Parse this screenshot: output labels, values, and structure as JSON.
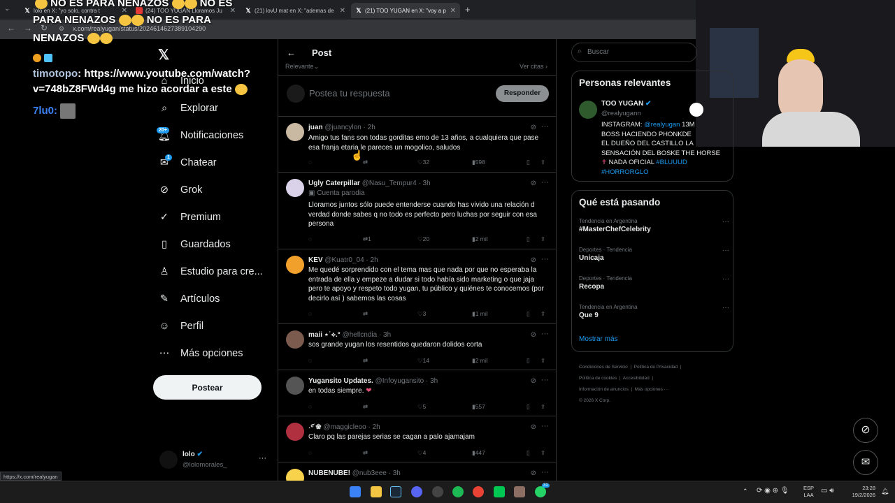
{
  "browser": {
    "tabs": [
      {
        "label": "lolo en X: \"yo solo, contra t"
      },
      {
        "label": "(24) TOO YUGAN Lloramos Ju"
      },
      {
        "label": "(21) lovU mat en X: \"ademas de"
      },
      {
        "label": "(21) TOO YUGAN en X: \"voy a p"
      }
    ],
    "url": "x.com/realyugan/status/2024614627389104290",
    "status_url": "https://x.com/realyugan"
  },
  "overlay_chat": {
    "line1": "NO ES PARA NENAZOS",
    "line1b": "NO ES",
    "line2": "PARA NENAZOS",
    "line2b": "NO ES PARA",
    "line3": "NENAZOS",
    "timo_user": "timotopo",
    "timo_msg": ": https://www.youtube.com/watch?",
    "timo_msg2": "v=748bZ8FWd4g me hizo acordar a este",
    "user3": "7lu0:"
  },
  "sidebar": {
    "items": [
      {
        "label": "Inicio"
      },
      {
        "label": "Explorar"
      },
      {
        "label": "Notificaciones",
        "badge": "20+"
      },
      {
        "label": "Chatear",
        "badge": "1"
      },
      {
        "label": "Grok"
      },
      {
        "label": "Premium"
      },
      {
        "label": "Guardados"
      },
      {
        "label": "Estudio para cre..."
      },
      {
        "label": "Artículos"
      },
      {
        "label": "Perfil"
      },
      {
        "label": "Más opciones"
      }
    ],
    "post_button": "Postear",
    "account_name": "lolo",
    "account_handle": "@lolomorales_",
    "account_more": "···"
  },
  "main": {
    "header_title": "Post",
    "sort_label": "Relevante",
    "quotes_label": "Ver citas",
    "reply_placeholder": "Postea tu respuesta",
    "reply_button": "Responder",
    "tweets": [
      {
        "name": "juan",
        "handle": "@juancylon · 2h",
        "text": "Amigo tus fans son todas gorditas emo de 13 años, a cualquiera que pase esa franja etaria le pareces un mogolico, saludos",
        "reposts": "",
        "likes": "32",
        "views": "598"
      },
      {
        "name": "Ugly Caterpillar",
        "handle": "@Nasu_Tempur4 · 3h",
        "sub": "Cuenta parodia",
        "text": "Lloramos juntos sólo puede entenderse cuando has vivido una relación d verdad donde sabes q no todo es perfecto pero luchas por seguir con esa persona",
        "reposts": "1",
        "likes": "20",
        "views": "2 mil"
      },
      {
        "name": "KEV",
        "handle": "@Kuatr0_04 · 2h",
        "text": "Me quedé sorprendido con el tema mas que nada por que no esperaba la entrada de ella y empeze a dudar si todo había sido marketing o que jaja pero te apoyo y respeto todo yugan, tu público y quiénes te conocemos (por decirlo así ) sabemos las cosas",
        "reposts": "",
        "likes": "3",
        "views": "1 mil"
      },
      {
        "name": "maii ⋆˙⟡.°",
        "handle": "@hellcndia · 3h",
        "text": "sos grande yugan los resentidos quedaron dolidos corta",
        "reposts": "",
        "likes": "14",
        "views": "2 mil"
      },
      {
        "name": "Yugansito Updates.",
        "handle": "@Infoyugansito · 3h",
        "text": "en todas siempre.",
        "reposts": "",
        "likes": "5",
        "views": "557"
      },
      {
        "name": "˖ᵒ᷄ ❀",
        "handle": "@maggicleoo · 2h",
        "text": "Claro pq las parejas serias se cagan a palo ajamajam",
        "reposts": "",
        "likes": "4",
        "views": "447"
      },
      {
        "name": "NUBENUBE!",
        "handle": "@nub3eee · 3h",
        "text": "",
        "reposts": "",
        "likes": "",
        "views": ""
      }
    ]
  },
  "right": {
    "search_placeholder": "Buscar",
    "relevant_title": "Personas relevantes",
    "person_name": "TOO YUGAN",
    "person_handle": "@realyugann",
    "bio_1": "INSTAGRAM: ",
    "bio_link": "@realyugan",
    "bio_2": " 13M",
    "bio_3": "BOSS HACIENDO PHONKDE",
    "bio_4": "EL DUEÑO DEL CASTILLO LA",
    "bio_5": "SENSACIÓN DEL BOSKE THE HORSE",
    "bio_6": "NADA OFICIAL ",
    "bio_tag1": "#BLUUUD",
    "bio_tag2": "#HORRORGLO",
    "trending_title": "Qué está pasando",
    "trends": [
      {
        "cat": "Tendencia en Argentina",
        "name": "#MasterChefCelebrity"
      },
      {
        "cat": "Deportes · Tendencia",
        "name": "Unicaja"
      },
      {
        "cat": "Deportes · Tendencia",
        "name": "Recopa"
      },
      {
        "cat": "Tendencia en Argentina",
        "name": "Que 9"
      }
    ],
    "show_more": "Mostrar más",
    "footer": [
      "Condiciones de Servicio",
      "Política de Privacidad",
      "Política de cookies",
      "Accesibilidad",
      "Información de anuncios",
      "Más opciones ···",
      "© 2026 X Corp."
    ]
  },
  "taskbar": {
    "lang1": "ESP",
    "lang2": "LAA",
    "time": "23:28",
    "date": "19/2/2026",
    "whatsapp_badge": "31"
  },
  "colors": {
    "accent": "#1d9bf0",
    "bg": "#000000",
    "border": "#2f3336"
  }
}
